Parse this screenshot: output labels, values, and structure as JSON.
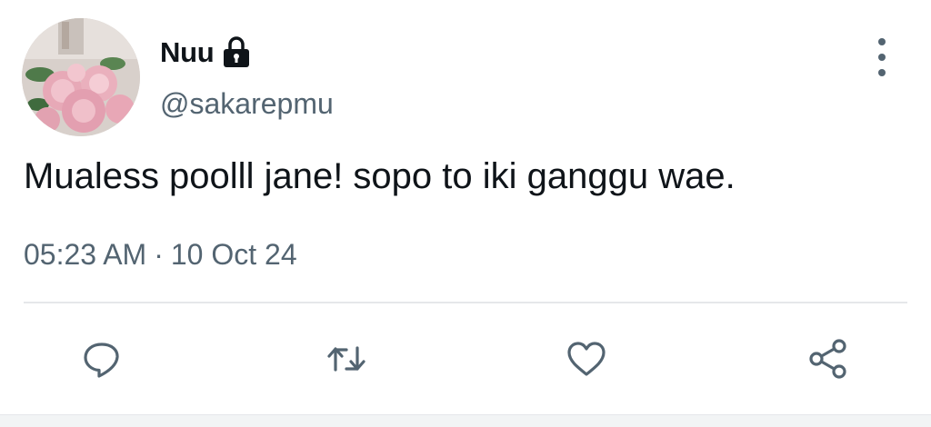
{
  "author": {
    "display_name": "Nuu",
    "handle": "@sakarepmu",
    "protected_icon": "lock-icon",
    "avatar": "pink-peony-flowers-photo"
  },
  "tweet": {
    "text": "Mualess poolll jane! sopo to iki ganggu wae.",
    "time": "05:23 AM",
    "separator": "·",
    "date": "10 Oct 24"
  },
  "actions": [
    {
      "name": "reply",
      "icon": "reply-bubble-icon"
    },
    {
      "name": "retweet",
      "icon": "retweet-icon"
    },
    {
      "name": "like",
      "icon": "heart-icon"
    },
    {
      "name": "share",
      "icon": "share-icon"
    }
  ],
  "menu_icon": "more-vertical-icon",
  "colors": {
    "text_primary": "#0f1419",
    "text_secondary": "#536471",
    "divider": "#e5e7ea",
    "background": "#ffffff"
  }
}
